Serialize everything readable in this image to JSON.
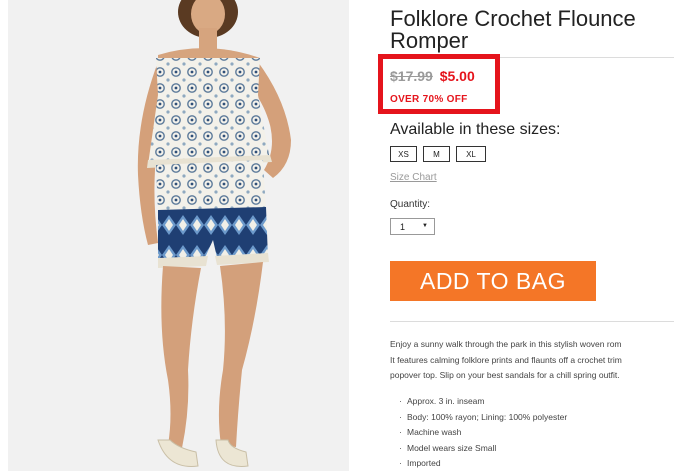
{
  "product": {
    "title_line1": "Folklore Crochet Flounce",
    "title_line2": "Romper",
    "old_price": "$17.99",
    "sale_price": "$5.00",
    "discount_text": "OVER 70% OFF",
    "accent_color": "#e5141c"
  },
  "sizes": {
    "heading": "Available in these sizes:",
    "options": [
      "XS",
      "M",
      "XL"
    ]
  },
  "size_chart_link": "Size Chart",
  "quantity": {
    "label": "Quantity:",
    "value": "1"
  },
  "add_to_bag": {
    "label": "ADD TO BAG",
    "color": "#f47627"
  },
  "description": {
    "lines": [
      "Enjoy a sunny walk through the park in this stylish woven rom",
      "It features calming folklore prints and flaunts off a crochet trim",
      "popover top. Slip on your best sandals for a chill spring outfit."
    ],
    "bullets": [
      "Approx. 3 in. inseam",
      "Body: 100% rayon; Lining: 100% polyester",
      "Machine wash",
      "Model wears size Small",
      "Imported"
    ]
  }
}
